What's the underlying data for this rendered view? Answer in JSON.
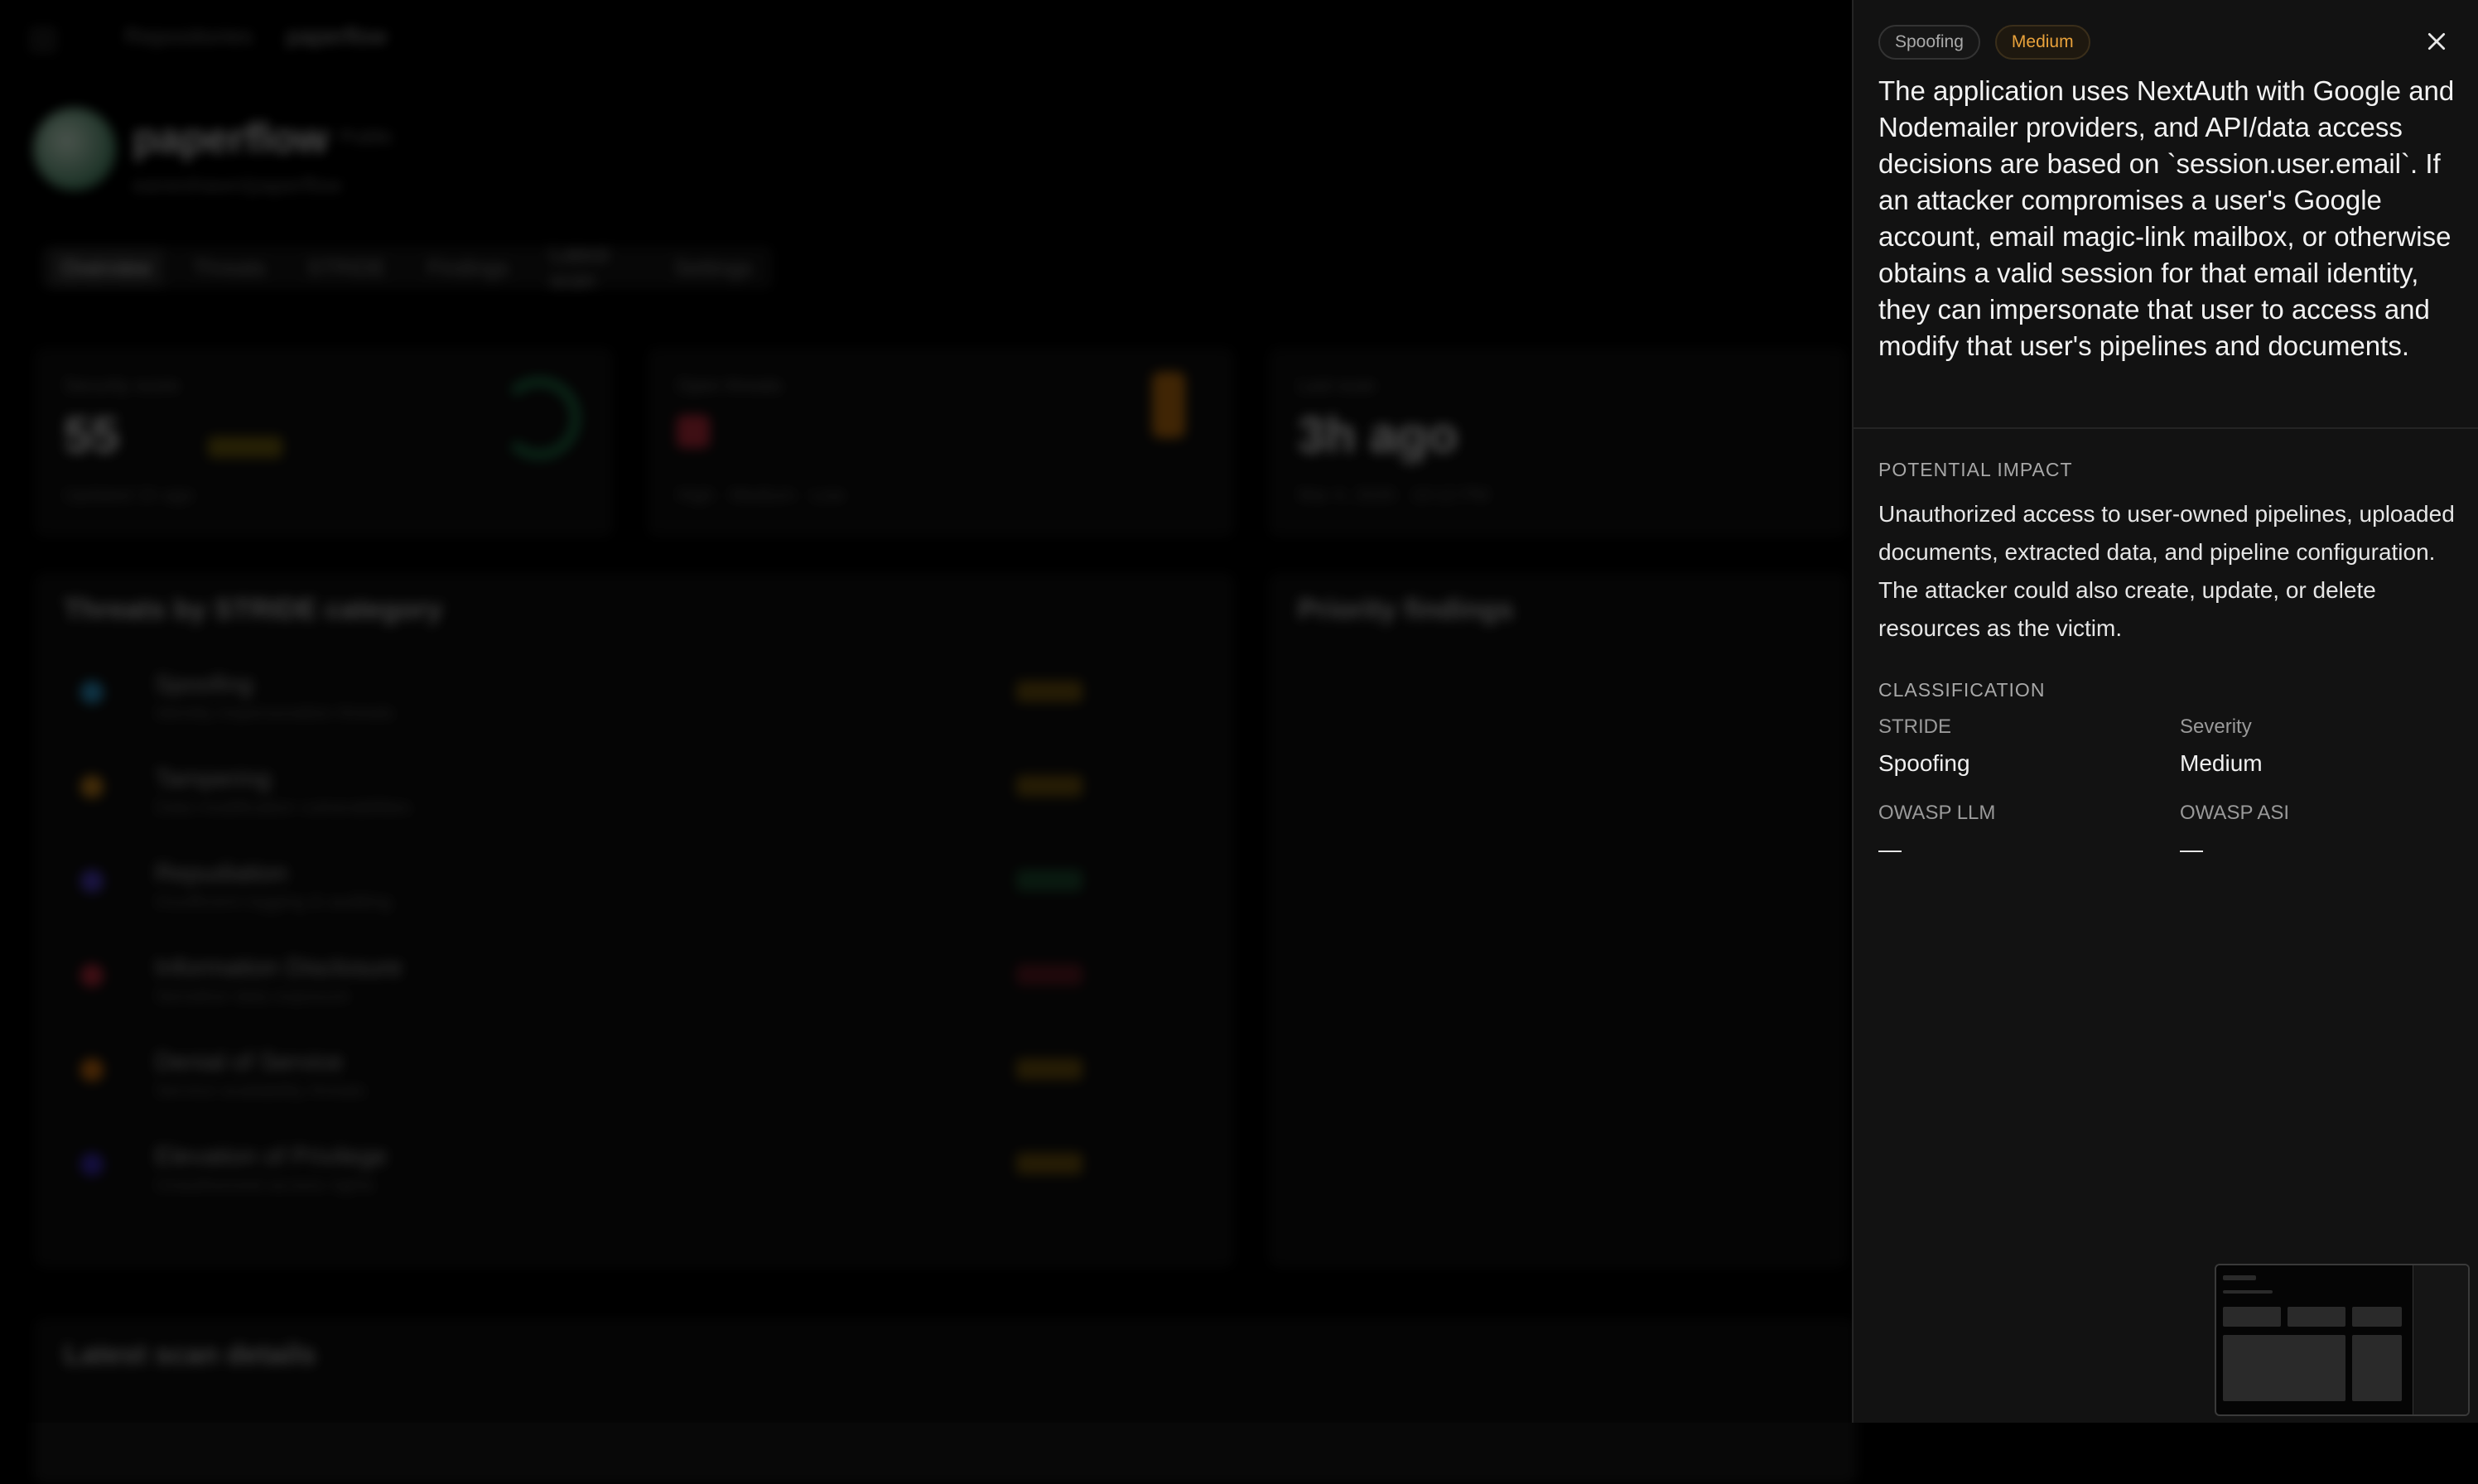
{
  "background": {
    "breadcrumbs": [
      "Repositories",
      "paperflow"
    ],
    "project": {
      "name": "paperflow",
      "pill": "Public",
      "subtitle": "eaneshawn/paperflow"
    },
    "tabs": [
      "Overview",
      "Threats",
      "STRIDE",
      "Findings",
      "Latest scan",
      "Settings"
    ],
    "cards": [
      {
        "label": "Security score",
        "value": "55",
        "note": "Updated 1h ago"
      },
      {
        "label": "Open threats",
        "value": "",
        "note": "High · Medium · Low"
      },
      {
        "label": "Last scan",
        "value": "3h ago",
        "note": "Mar 4, 2026 · 10:12 PM"
      }
    ],
    "threats_title": "Threats by STRIDE category",
    "threat_rows": [
      {
        "name": "Spoofing",
        "desc": "Identity impersonation threats"
      },
      {
        "name": "Tampering",
        "desc": "Data modification vulnerabilities"
      },
      {
        "name": "Repudiation",
        "desc": "Insufficient logging & auditing"
      },
      {
        "name": "Information Disclosure",
        "desc": "Sensitive data exposure"
      },
      {
        "name": "Denial of Service",
        "desc": "Service availability threats"
      },
      {
        "name": "Elevation of Privilege",
        "desc": "Unauthorized access rights"
      }
    ],
    "priority_title": "Priority findings",
    "latest_title": "Latest scan details"
  },
  "panel": {
    "stride_tag": "Spoofing",
    "severity_tag": "Medium",
    "description": "The application uses NextAuth with Google and Nodemailer providers, and API/data access decisions are based on `session.user.email`. If an attacker compromises a user's Google account, email magic-link mailbox, or otherwise obtains a valid session for that email identity, they can impersonate that user to access and modify that user's pipelines and documents.",
    "impact_label": "POTENTIAL IMPACT",
    "impact": "Unauthorized access to user-owned pipelines, uploaded documents, extracted data, and pipeline configuration. The attacker could also create, update, or delete resources as the victim.",
    "classification_label": "CLASSIFICATION",
    "fields": {
      "stride_label": "STRIDE",
      "stride_value": "Spoofing",
      "severity_label": "Severity",
      "severity_value": "Medium",
      "owasp_llm_label": "OWASP LLM",
      "owasp_llm_value": "—",
      "owasp_asi_label": "OWASP ASI",
      "owasp_asi_value": "—"
    }
  },
  "colors": {
    "severity_medium": "#e9a23b",
    "panel_bg": "#121212"
  }
}
